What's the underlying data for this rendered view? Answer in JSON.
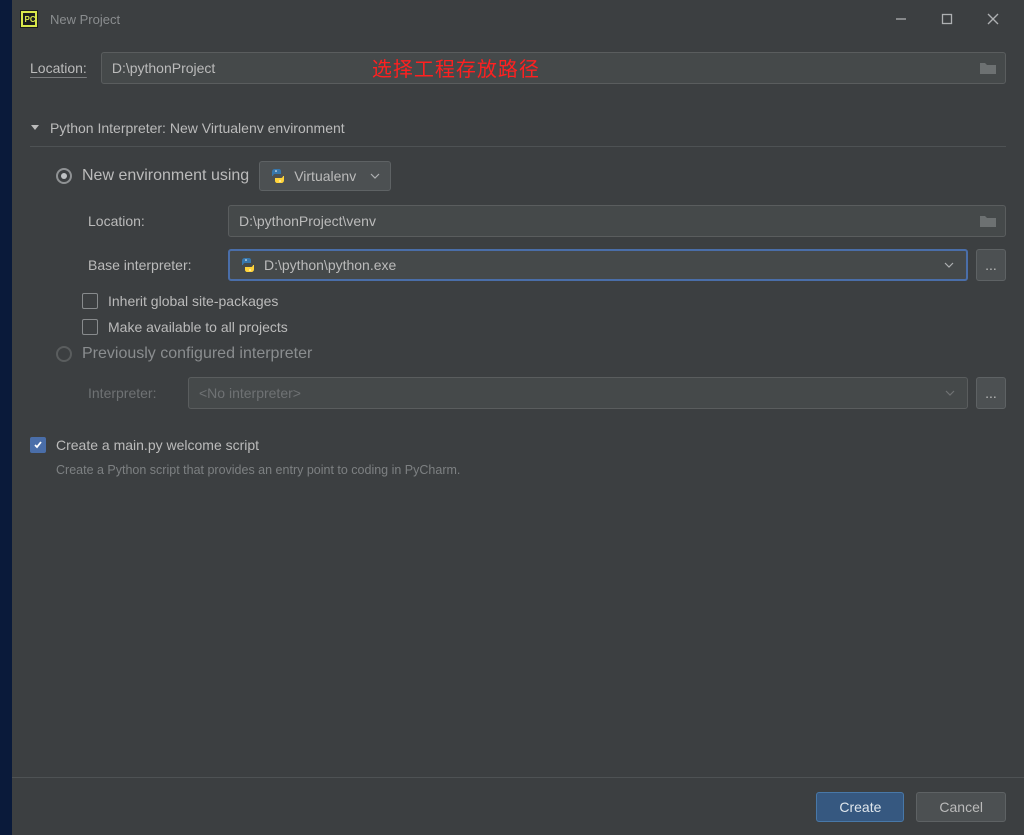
{
  "window": {
    "title": "New Project"
  },
  "location": {
    "label": "Location:",
    "value": "D:\\pythonProject",
    "annotation": "选择工程存放路径"
  },
  "interpreter_section": {
    "title": "Python Interpreter: New Virtualenv environment"
  },
  "new_env": {
    "radio_label": "New environment using",
    "dropdown_value": "Virtualenv",
    "location": {
      "label": "Location:",
      "value": "D:\\pythonProject\\venv"
    },
    "base_interpreter": {
      "label": "Base interpreter:",
      "value": "D:\\python\\python.exe"
    },
    "inherit_label": "Inherit global site-packages",
    "available_label": "Make available to all projects"
  },
  "prev_env": {
    "radio_label": "Previously configured interpreter",
    "interpreter_label": "Interpreter:",
    "interpreter_value": "<No interpreter>"
  },
  "welcome_script": {
    "label": "Create a main.py welcome script",
    "hint": "Create a Python script that provides an entry point to coding in PyCharm."
  },
  "buttons": {
    "create": "Create",
    "cancel": "Cancel"
  }
}
